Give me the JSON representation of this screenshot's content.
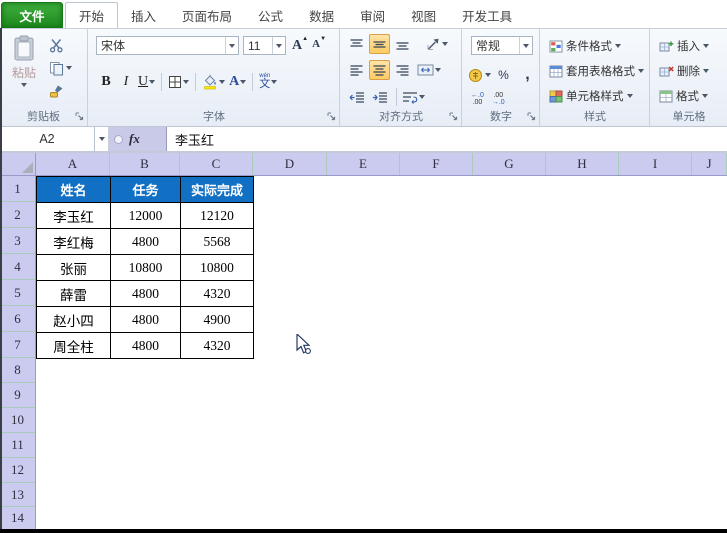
{
  "tab_bar": {
    "file_tab": "文件",
    "tabs": [
      {
        "label": "开始",
        "active": true
      },
      {
        "label": "插入",
        "active": false
      },
      {
        "label": "页面布局",
        "active": false
      },
      {
        "label": "公式",
        "active": false
      },
      {
        "label": "数据",
        "active": false
      },
      {
        "label": "审阅",
        "active": false
      },
      {
        "label": "视图",
        "active": false
      },
      {
        "label": "开发工具",
        "active": false
      }
    ]
  },
  "ribbon": {
    "clipboard": {
      "group_label": "剪贴板",
      "paste_label": "粘贴"
    },
    "font": {
      "group_label": "字体",
      "font_name": "宋体",
      "font_size": "11",
      "bold": "B",
      "italic": "I",
      "underline": "U",
      "grow": "A",
      "shrink": "A",
      "phonetic_char": "文",
      "phonetic_hint": "wén"
    },
    "alignment": {
      "group_label": "对齐方式"
    },
    "number": {
      "group_label": "数字",
      "format": "常规",
      "percent": "%",
      "comma": ",",
      "inc_decimal_top": "←.0",
      "inc_decimal_bottom": ".00",
      "dec_decimal_top": ".00",
      "dec_decimal_bottom": "→.0"
    },
    "styles": {
      "group_label": "样式",
      "conditional": "条件格式",
      "format_as_table": "套用表格格式",
      "cell_styles": "单元格样式"
    },
    "cells": {
      "group_label": "单元格",
      "insert": "插入",
      "delete": "删除",
      "format": "格式"
    }
  },
  "formula_bar": {
    "name_box": "A2",
    "fx": "fx",
    "formula": "李玉红"
  },
  "sheet": {
    "column_headers": [
      "A",
      "B",
      "C",
      "D",
      "E",
      "F",
      "G",
      "H",
      "I",
      "J"
    ],
    "row_headers": [
      "1",
      "2",
      "3",
      "4",
      "5",
      "6",
      "7",
      "8",
      "9",
      "10",
      "11",
      "12",
      "13",
      "14"
    ]
  },
  "table": {
    "headers": [
      "姓名",
      "任务",
      "实际完成"
    ],
    "rows": [
      [
        "李玉红",
        "12000",
        "12120"
      ],
      [
        "李红梅",
        "4800",
        "5568"
      ],
      [
        "张丽",
        "10800",
        "10800"
      ],
      [
        "薛雷",
        "4800",
        "4320"
      ],
      [
        "赵小四",
        "4800",
        "4900"
      ],
      [
        "周全柱",
        "4800",
        "4320"
      ]
    ]
  },
  "colors": {
    "table_header_fill": "#1170C4",
    "table_header_text": "#FFFFFF",
    "file_tab_green": "#2DA12D",
    "grid_header_bg": "#CBCBEF",
    "grid_header_line": "#A9CBB9",
    "highlight_button": "#FFCB63",
    "fill_swatch_yellow": "#FFE800",
    "ribbon_bg": "#EFF3F9"
  },
  "icons": {
    "dropdown": "▾",
    "grow_caret": "▲",
    "shrink_caret": "▼"
  }
}
